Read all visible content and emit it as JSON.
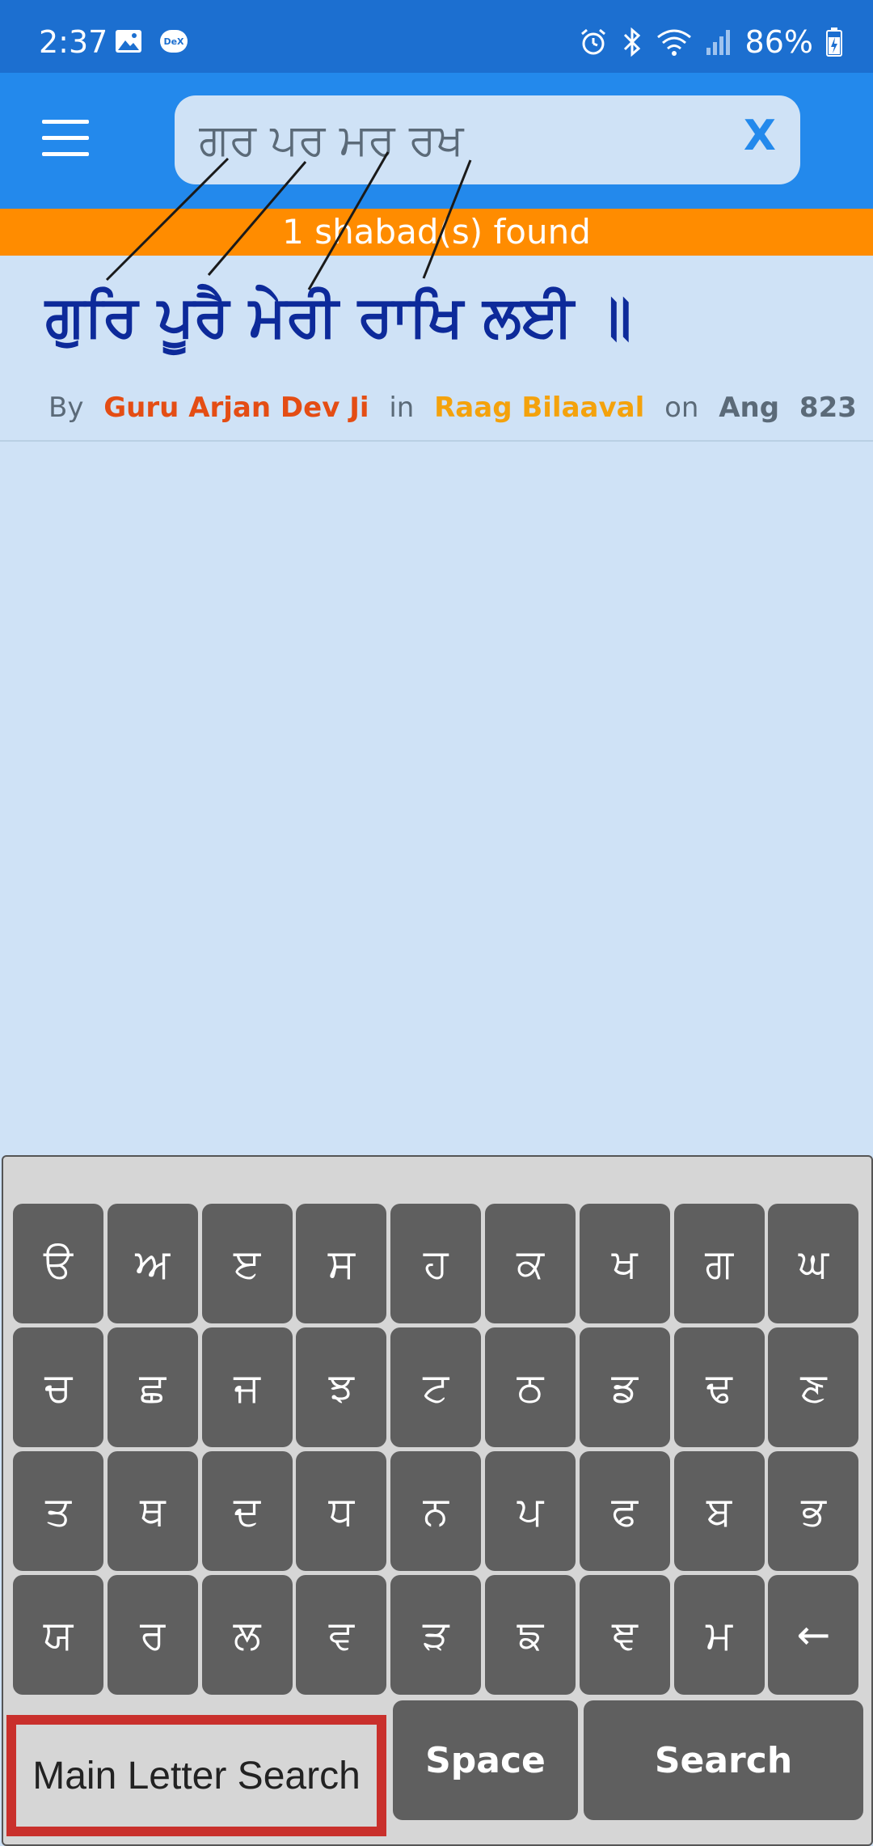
{
  "status_bar": {
    "time": "2:37",
    "battery": "86%",
    "icons": [
      "image-icon",
      "dex-icon",
      "alarm-icon",
      "bluetooth-icon",
      "wifi-icon",
      "signal-icon",
      "battery-icon"
    ],
    "dex_label": "DeX"
  },
  "header": {
    "menu_icon": "hamburger-menu-icon",
    "search_value": "ਗਰ ਪਰ ਮਰ ਰਖ",
    "clear_label": "X",
    "accent_color": "#2389ec"
  },
  "results": {
    "banner": "1 shabad(s) found",
    "banner_color": "#ff8c00"
  },
  "result_card": {
    "line": "ਗੁਰਿ ਪੂਰੈ ਮੇਰੀ ਰਾਖਿ ਲਈ ॥",
    "by_label": "By",
    "author": "Guru Arjan Dev Ji",
    "in_label": "in",
    "raag": "Raag Bilaaval",
    "on_label": "on",
    "ang_label": "Ang",
    "ang_number": "823"
  },
  "keyboard": {
    "rows": [
      [
        "ੳ",
        "ਅ",
        "ੲ",
        "ਸ",
        "ਹ",
        "ਕ",
        "ਖ",
        "ਗ",
        "ਘ"
      ],
      [
        "ਚ",
        "ਛ",
        "ਜ",
        "ਝ",
        "ਟ",
        "ਠ",
        "ਡ",
        "ਢ",
        "ਣ"
      ],
      [
        "ਤ",
        "ਥ",
        "ਦ",
        "ਧ",
        "ਨ",
        "ਪ",
        "ਫ",
        "ਬ",
        "ਭ"
      ],
      [
        "ਯ",
        "ਰ",
        "ਲ",
        "ਵ",
        "ੜ",
        "ਙ",
        "ਞ",
        "ਮ",
        "←"
      ]
    ],
    "main_letter_search": "Main Letter Search",
    "space": "Space",
    "search": "Search"
  }
}
